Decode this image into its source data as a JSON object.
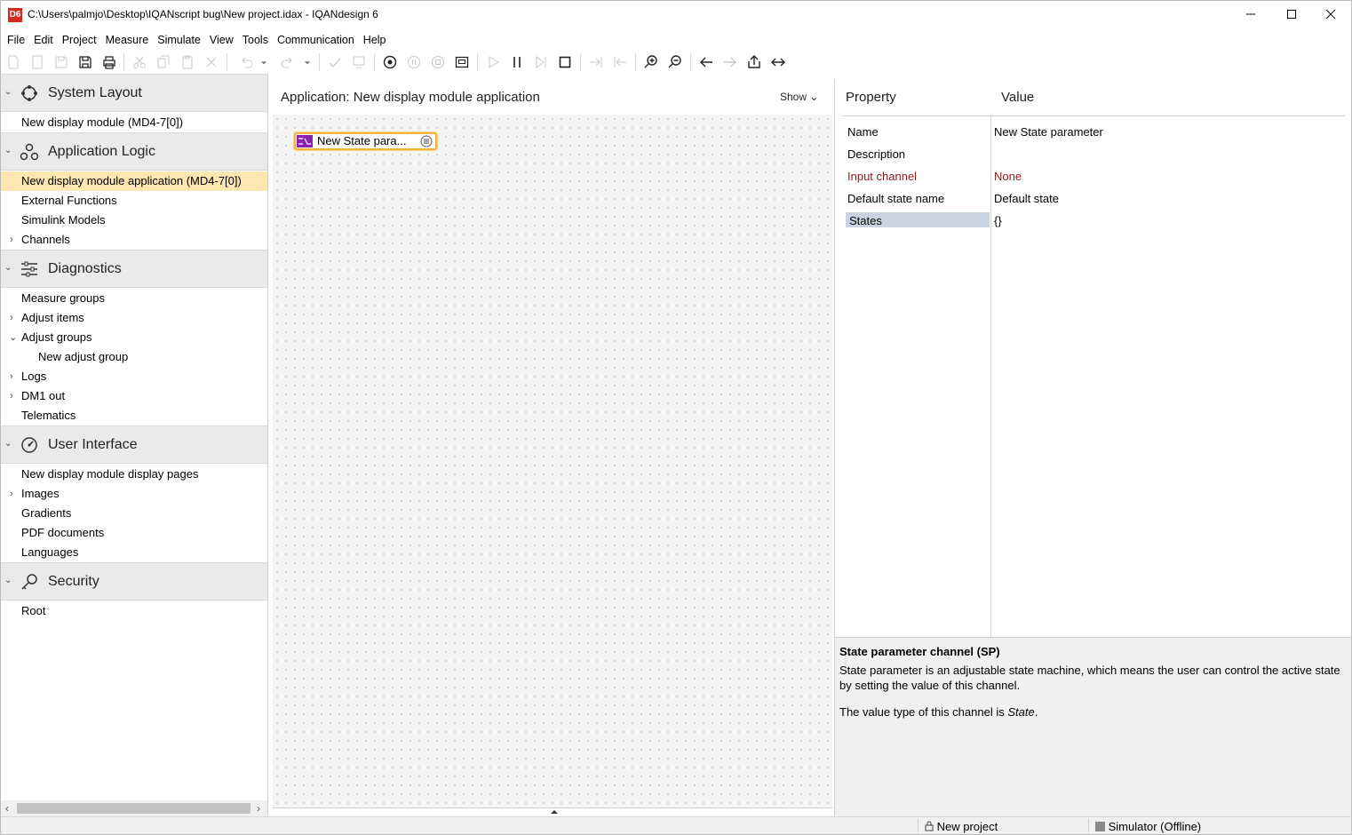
{
  "window": {
    "title": "C:\\Users\\palmjo\\Desktop\\IQANscript bug\\New project.idax - IQANdesign 6",
    "logo_text": "D6"
  },
  "menu": [
    "File",
    "Edit",
    "Project",
    "Measure",
    "Simulate",
    "View",
    "Tools",
    "Communication",
    "Help"
  ],
  "sidebar": {
    "system_layout": {
      "title": "System Layout",
      "items": [
        "New display module (MD4-7[0])"
      ]
    },
    "application_logic": {
      "title": "Application Logic",
      "items": [
        "New display module application (MD4-7[0])",
        "External Functions",
        "Simulink Models",
        "Channels"
      ]
    },
    "diagnostics": {
      "title": "Diagnostics",
      "items": [
        "Measure groups",
        "Adjust items",
        "Adjust groups",
        "New adjust group",
        "Logs",
        "DM1 out",
        "Telematics"
      ]
    },
    "user_interface": {
      "title": "User Interface",
      "items": [
        "New display module display pages",
        "Images",
        "Gradients",
        "PDF documents",
        "Languages"
      ]
    },
    "security": {
      "title": "Security",
      "items": [
        "Root"
      ]
    }
  },
  "canvas": {
    "title": "Application: New display module application",
    "show_label": "Show",
    "node_label": "New State para..."
  },
  "properties": {
    "property_header": "Property",
    "value_header": "Value",
    "rows": [
      {
        "name": "Name",
        "value": "New State parameter"
      },
      {
        "name": "Description",
        "value": ""
      },
      {
        "name": "Input channel",
        "value": "None"
      },
      {
        "name": "Default state name",
        "value": "Default state"
      },
      {
        "name": "States",
        "value": "{}"
      }
    ]
  },
  "description": {
    "title": "State parameter channel (SP)",
    "body": "State parameter is an adjustable state machine, which means the user can control the active state by setting the value of this channel.",
    "type_prefix": "The value type of this channel is ",
    "type_value": "State",
    "type_suffix": "."
  },
  "status": {
    "project": "New project",
    "simulator": "Simulator (Offline)"
  },
  "colors": {
    "selected_tree": "#fde6b1",
    "node_border": "#f3b33d",
    "node_icon": "#8e1fb3",
    "input_red": "#8b1a1a"
  }
}
